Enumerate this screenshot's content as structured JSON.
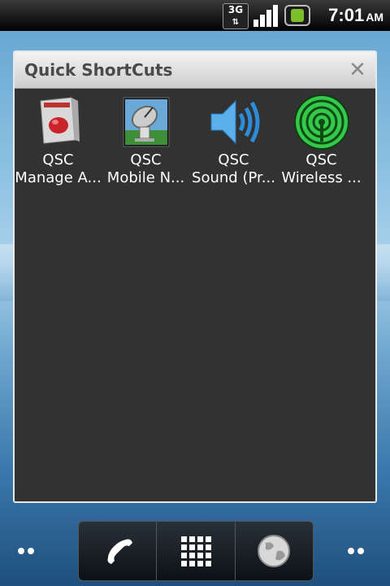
{
  "status_bar": {
    "network": "3G",
    "time": "7:01",
    "ampm": "AM"
  },
  "dialog": {
    "title": "Quick ShortCuts",
    "close_icon": "close-icon",
    "shortcuts": [
      {
        "line1": "QSC",
        "line2": "Manage A...",
        "icon": "manage-apps-icon"
      },
      {
        "line1": "QSC",
        "line2": "Mobile N...",
        "icon": "satellite-dish-icon"
      },
      {
        "line1": "QSC",
        "line2": "Sound (Pr...",
        "icon": "speaker-icon"
      },
      {
        "line1": "QSC",
        "line2": "Wireless ...",
        "icon": "wireless-icon"
      }
    ]
  },
  "dock": {
    "items": [
      {
        "icon": "phone-icon"
      },
      {
        "icon": "app-drawer-icon"
      },
      {
        "icon": "browser-globe-icon"
      }
    ]
  },
  "colors": {
    "dialog_bg": "#323232",
    "header_bg": "#dedede",
    "accent_blue": "#2e8bd8",
    "accent_green": "#36c84a"
  }
}
